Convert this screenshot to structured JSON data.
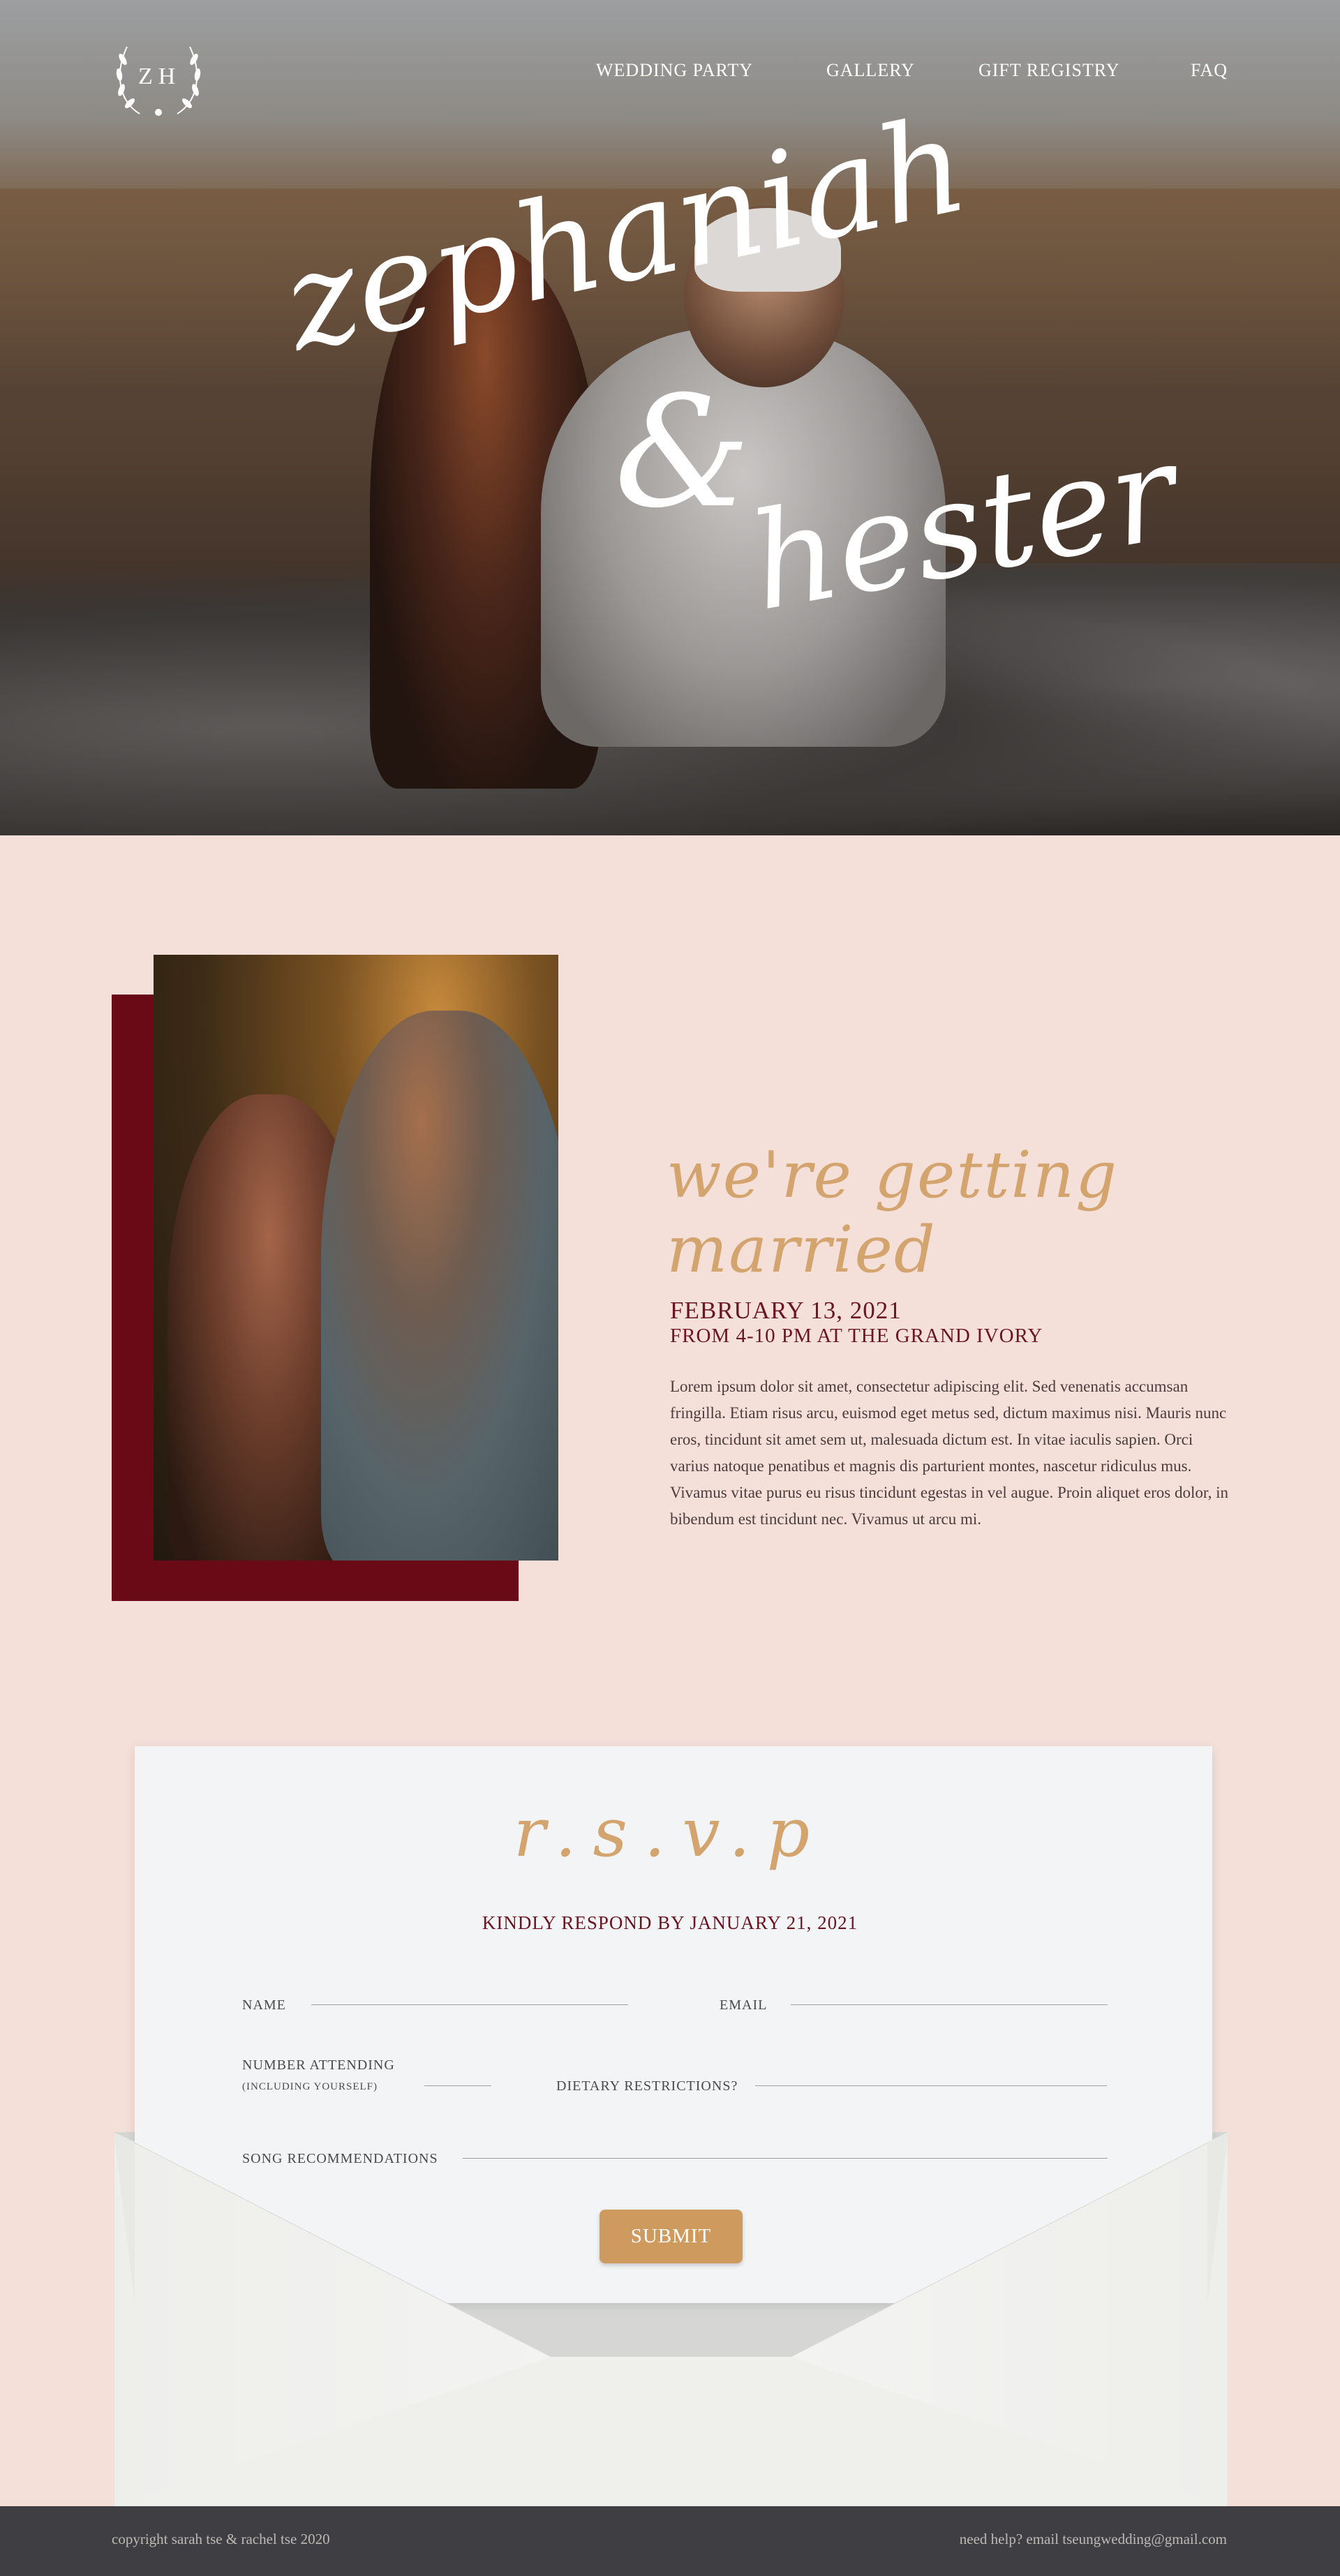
{
  "nav": {
    "logo_letters": "ZH",
    "items": [
      "WEDDING PARTY",
      "GALLERY",
      "GIFT REGISTRY",
      "FAQ"
    ]
  },
  "hero": {
    "name1": "zephaniah",
    "amp": "&",
    "name2": "hester"
  },
  "details": {
    "heading": "we're getting married",
    "date": "FEBRUARY 13, 2021",
    "time_place": "FROM 4-10 PM AT THE GRAND IVORY",
    "body": "Lorem ipsum dolor sit amet, consectetur adipiscing elit. Sed venenatis accumsan fringilla. Etiam risus arcu, euismod eget metus sed, dictum maximus nisi. Mauris nunc eros, tincidunt sit amet sem ut, malesuada dictum est. In vitae iaculis sapien. Orci varius natoque penatibus et magnis dis parturient montes, nascetur ridiculus mus. Vivamus vitae purus eu risus tincidunt egestas in vel augue. Proin aliquet eros dolor, in bibendum est tincidunt nec. Vivamus ut arcu mi."
  },
  "rsvp": {
    "title": "r.s.v.p",
    "respond_by": "KINDLY RESPOND BY JANUARY 21, 2021",
    "fields": {
      "name": "NAME",
      "email": "EMAIL",
      "number": "NUMBER ATTENDING",
      "number_sub": "(INCLUDING YOURSELF)",
      "dietary": "DIETARY RESTRICTIONS?",
      "songs": "SONG RECOMMENDATIONS"
    },
    "submit": "SUBMIT"
  },
  "footer": {
    "copyright": "copyright sarah tse & rachel tse 2020",
    "help": "need help? email tseungwedding@gmail.com"
  },
  "colors": {
    "blush": "#f4dfd9",
    "burgundy": "#6a0a16",
    "gold": "#d3a46e",
    "button": "#cf9a5e",
    "footer": "#3f3e42"
  }
}
